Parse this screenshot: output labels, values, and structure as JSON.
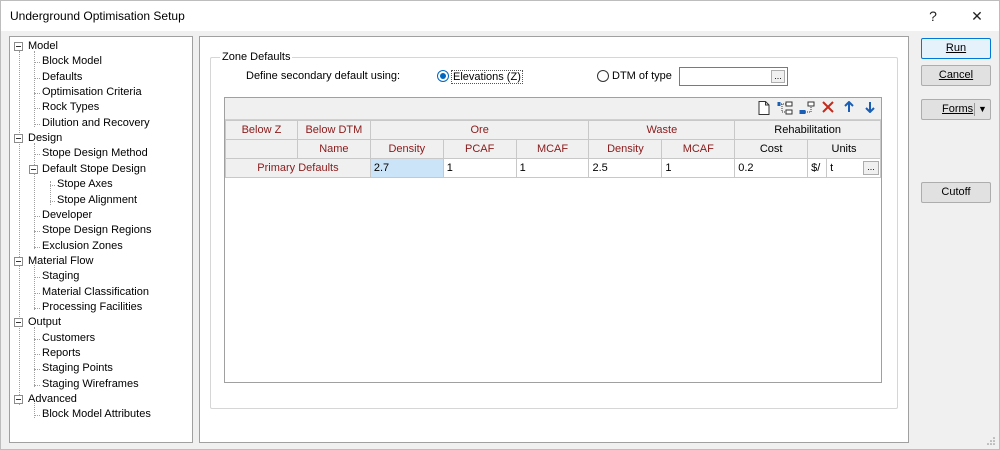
{
  "window": {
    "title": "Underground Optimisation Setup",
    "help_glyph": "?",
    "close_glyph": "✕"
  },
  "tree": {
    "items": [
      {
        "label": "Model",
        "level": 0
      },
      {
        "label": "Block Model",
        "level": 1
      },
      {
        "label": "Defaults",
        "level": 1
      },
      {
        "label": "Optimisation Criteria",
        "level": 1
      },
      {
        "label": "Rock Types",
        "level": 1
      },
      {
        "label": "Dilution and Recovery",
        "level": 1
      },
      {
        "label": "Design",
        "level": 0
      },
      {
        "label": "Stope Design Method",
        "level": 1
      },
      {
        "label": "Default Stope Design",
        "level": 1
      },
      {
        "label": "Stope Axes",
        "level": 2
      },
      {
        "label": "Stope Alignment",
        "level": 2
      },
      {
        "label": "Developer",
        "level": 1
      },
      {
        "label": "Stope Design Regions",
        "level": 1
      },
      {
        "label": "Exclusion Zones",
        "level": 1
      },
      {
        "label": "Material Flow",
        "level": 0
      },
      {
        "label": "Staging",
        "level": 1
      },
      {
        "label": "Material Classification",
        "level": 1
      },
      {
        "label": "Processing Facilities",
        "level": 1
      },
      {
        "label": "Output",
        "level": 0
      },
      {
        "label": "Customers",
        "level": 1
      },
      {
        "label": "Reports",
        "level": 1
      },
      {
        "label": "Staging Points",
        "level": 1
      },
      {
        "label": "Staging Wireframes",
        "level": 1
      },
      {
        "label": "Advanced",
        "level": 0
      },
      {
        "label": "Block Model Attributes",
        "level": 1
      }
    ]
  },
  "zone": {
    "group_label": "Zone Defaults",
    "define_label": "Define secondary default using:",
    "radio_elevations": "Elevations (Z)",
    "radio_dtm": "DTM of type",
    "dtm_value": "",
    "ellipsis": "..."
  },
  "grid": {
    "headers_top": {
      "below_z": "Below Z",
      "below_dtm": "Below DTM",
      "ore": "Ore",
      "waste": "Waste",
      "rehab": "Rehabilitation"
    },
    "headers_sub": {
      "name": "Name",
      "ore_density": "Density",
      "pcaf": "PCAF",
      "ore_mcaf": "MCAF",
      "waste_density": "Density",
      "waste_mcaf": "MCAF",
      "cost": "Cost",
      "units": "Units"
    },
    "row": {
      "name": "Primary Defaults",
      "ore_density": "2.7",
      "pcaf": "1",
      "ore_mcaf": "1",
      "waste_density": "2.5",
      "waste_mcaf": "1",
      "cost": "0.2",
      "units_prefix": "$/",
      "units_value": "t",
      "ellipsis": "..."
    }
  },
  "buttons": {
    "run": "Run",
    "cancel": "Cancel",
    "forms": "Forms",
    "cutoff": "Cutoff"
  }
}
